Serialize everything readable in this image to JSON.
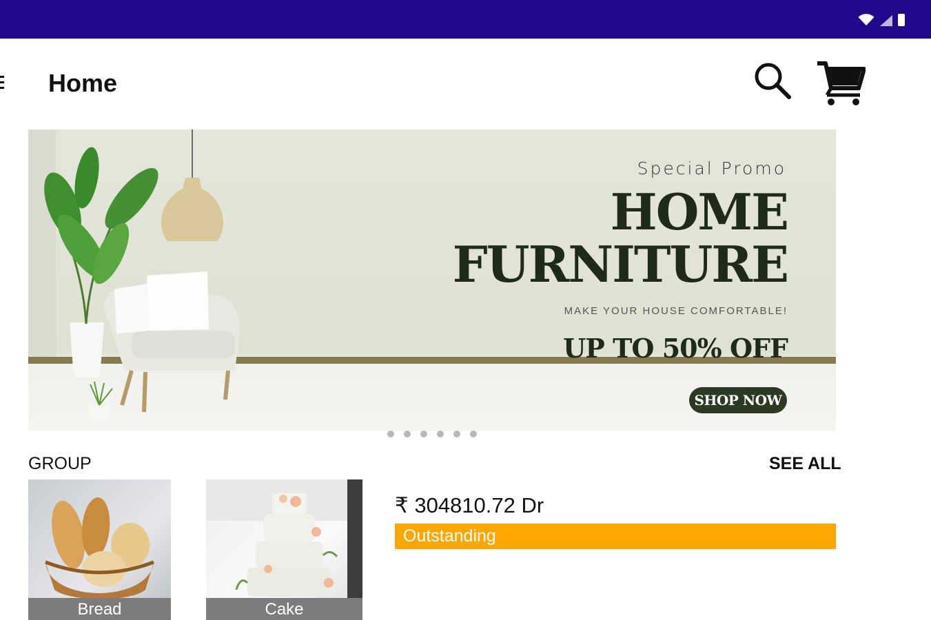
{
  "header": {
    "title": "Home"
  },
  "banner": {
    "subtitle": "Special Promo",
    "title_line1": "HOME",
    "title_line2": "FURNITURE",
    "tagline": "MAKE YOUR HOUSE COMFORTABLE!",
    "discount": "UP TO 50% OFF",
    "button_label": "SHOP NOW",
    "slide_count": 6
  },
  "group": {
    "label": "GROUP",
    "see_all_label": "SEE ALL",
    "items": [
      {
        "label": "Bread"
      },
      {
        "label": "Cake"
      }
    ]
  },
  "account": {
    "amount": "₹ 304810.72 Dr",
    "status_label": "Outstanding"
  },
  "colors": {
    "status_bar": "#22078a",
    "outstanding": "#ffa600",
    "promo_dark": "#1f2a18"
  },
  "icons": [
    "wifi-icon",
    "signal-icon",
    "battery-icon",
    "menu-icon",
    "search-icon",
    "cart-icon"
  ]
}
